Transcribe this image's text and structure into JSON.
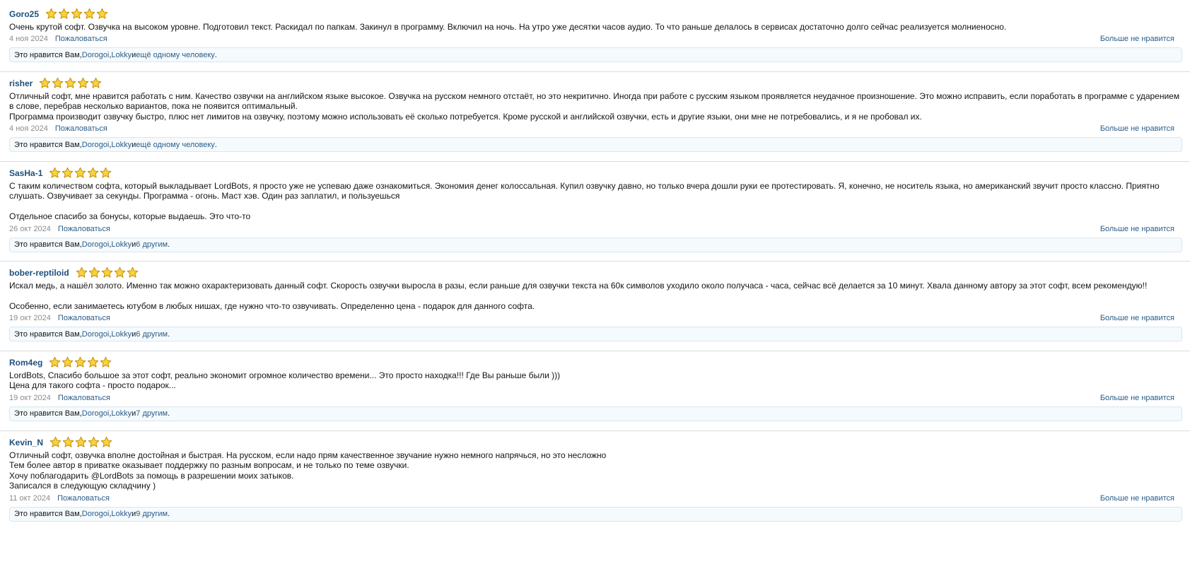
{
  "colors": {
    "username": "#1d4f7c",
    "link": "#2b5d8a",
    "star_fill": "#f9d23c",
    "star_stroke": "#c28a00",
    "date": "#8c8c8c"
  },
  "common": {
    "report": "Пожаловаться",
    "unlike": "Больше не нравится",
    "likes_prefix": "Это нравится Вам, ",
    "liker1": "Dorogoi",
    "comma": ", ",
    "liker2": "Lokky",
    "and": " и ",
    "star_icon": "star-icon",
    "rating": 5
  },
  "reviews": [
    {
      "user": "Goro25",
      "text": "Очень крутой софт. Озвучка на высоком уровне. Подготовил текст. Раскидал по папкам. Закинул в программу. Включил на ночь. На утро уже десятки часов аудио. То что раньше делалось в сервисах достаточно долго сейчас реализуется молниеносно.",
      "date": "4 ноя 2024",
      "others": "ещё одному человеку",
      "end": "."
    },
    {
      "user": "risher",
      "text": "Отличный софт, мне нравится работать с ним. Качество озвучки на английском языке высокое. Озвучка на русском немного отстаёт, но это некритично. Иногда при работе с русским языком проявляется неудачное произношение. Это можно исправить, если поработать в программе с ударением\nв слове, перебрав несколько вариантов, пока не появится оптимальный.\nПрограмма производит озвучку быстро, плюс нет лимитов на озвучку, поэтому можно использовать её сколько потребуется. Кроме русской и английской озвучки, есть и другие языки, они мне не потребовались, и я не пробовал их.",
      "date": "4 ноя 2024",
      "others": "ещё одному человеку",
      "end": "."
    },
    {
      "user": "SasHa-1",
      "text": "С таким количеством софта, который выкладывает LordBots, я просто уже не успеваю даже ознакомиться. Экономия денег колоссальная. Купил озвучку давно, но только вчера дошли руки ее протестировать. Я, конечно, не носитель языка, но американский звучит просто классно. Приятно\nслушать. Озвучивает за секунды. Программа - огонь. Маст хэв. Один раз заплатил, и пользуешься\n\nОтдельное спасибо за бонусы, которые выдаешь. Это что-то",
      "date": "26 окт 2024",
      "others": "6 другим",
      "end": "."
    },
    {
      "user": "bober-reptiloid",
      "text": "Искал медь, а нашёл золото. Именно так можно охарактеризовать данный софт. Скорость озвучки выросла в разы, если раньше для озвучки текста на 60к символов уходило около получаса - часа, сейчас всё делается за 10 минут. Хвала данному автору за этот софт, всем рекомендую!!\n\nОсобенно, если занимаетесь ютубом в любых нишах, где нужно что-то озвучивать. Определенно цена - подарок для данного софта.",
      "date": "19 окт 2024",
      "others": "6 другим",
      "end": "."
    },
    {
      "user": "Rom4eg",
      "text": "LordBots, Спасибо большое за этот софт, реально экономит огромное количество времени... Это просто находка!!! Где Вы раньше были )))\nЦена для такого софта - просто подарок...",
      "date": "19 окт 2024",
      "others": "7 другим",
      "end": "."
    },
    {
      "user": "Kevin_N",
      "text": "Отличный софт, озвучка вполне достойная и быстрая. На русском, если надо прям качественное звучание нужно немного напрячься, но это несложно\nТем более автор в приватке оказывает поддержку по разным вопросам, и не только по теме озвучки.\nХочу поблагодарить @LordBots за помощь в разрешении моих затыков.\nЗаписался в следующую складчину )",
      "date": "11 окт 2024",
      "others": "9 другим",
      "end": "."
    }
  ]
}
